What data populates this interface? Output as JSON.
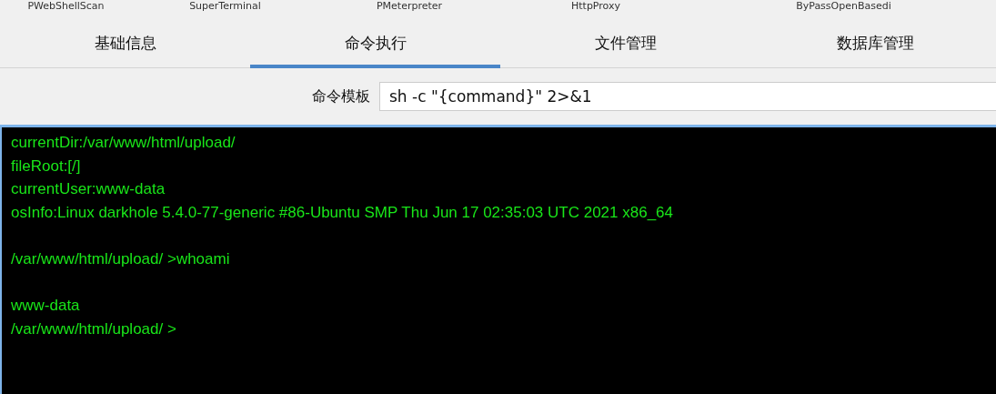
{
  "plugin_tabs": [
    {
      "label": "PWebShellScan",
      "selected": false
    },
    {
      "label": "SuperTerminal",
      "selected": false
    },
    {
      "label": "PMeterpreter",
      "selected": false
    },
    {
      "label": "HttpProxy",
      "selected": false
    },
    {
      "label": "ByPassOpenBasedi",
      "selected": false
    }
  ],
  "tabs": [
    {
      "label": "基础信息",
      "selected": false
    },
    {
      "label": "命令执行",
      "selected": true
    },
    {
      "label": "文件管理",
      "selected": false
    },
    {
      "label": "数据库管理",
      "selected": false
    }
  ],
  "command_template": {
    "label": "命令模板",
    "value": "sh -c \"{command}\" 2>&1"
  },
  "terminal": {
    "blocks": [
      {
        "lines": [
          "currentDir:/var/www/html/upload/",
          "fileRoot:[/]",
          "currentUser:www-data",
          "osInfo:Linux darkhole 5.4.0-77-generic #86-Ubuntu SMP Thu Jun 17 02:35:03 UTC 2021 x86_64"
        ]
      },
      {
        "lines": [
          "/var/www/html/upload/ >whoami"
        ]
      },
      {
        "lines": [
          "www-data",
          "/var/www/html/upload/ >"
        ]
      }
    ]
  }
}
